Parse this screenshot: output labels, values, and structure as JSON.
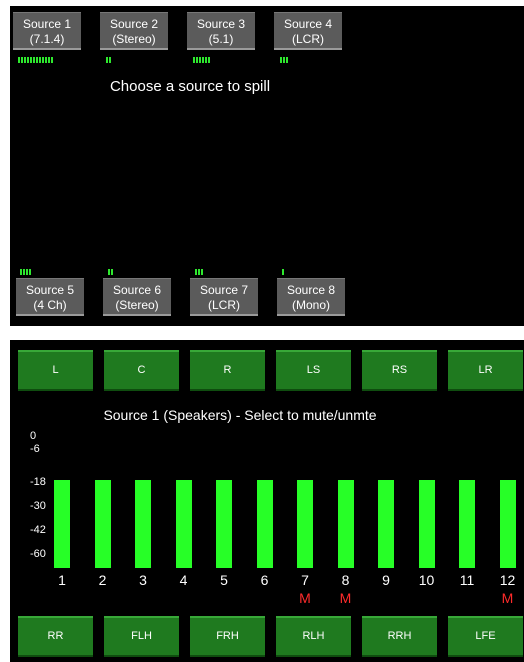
{
  "sources_top": [
    {
      "line1": "Source 1",
      "line2": "(7.1.4)",
      "meter_segments": 12
    },
    {
      "line1": "Source 2",
      "line2": "(Stereo)",
      "meter_segments": 2
    },
    {
      "line1": "Source 3",
      "line2": "(5.1)",
      "meter_segments": 6
    },
    {
      "line1": "Source 4",
      "line2": "(LCR)",
      "meter_segments": 3
    }
  ],
  "spill_prompt": "Choose a source to spill",
  "sources_bottom": [
    {
      "line1": "Source 5",
      "line2": "(4 Ch)",
      "meter_segments": 4
    },
    {
      "line1": "Source 6",
      "line2": "(Stereo)",
      "meter_segments": 2
    },
    {
      "line1": "Source 7",
      "line2": "(LCR)",
      "meter_segments": 3
    },
    {
      "line1": "Source 8",
      "line2": "(Mono)",
      "meter_segments": 1
    }
  ],
  "top_channel_buttons": [
    "L",
    "C",
    "R",
    "LS",
    "RS",
    "LR"
  ],
  "bottom_caption": "Source 1 (Speakers) - Select to mute/unmte",
  "scale_labels": [
    "0",
    "-6",
    "-18",
    "-30",
    "-42",
    "-60"
  ],
  "channels": [
    {
      "num": "1",
      "level": 1.0,
      "muted": false
    },
    {
      "num": "2",
      "level": 1.0,
      "muted": false
    },
    {
      "num": "3",
      "level": 1.0,
      "muted": false
    },
    {
      "num": "4",
      "level": 1.0,
      "muted": false
    },
    {
      "num": "5",
      "level": 1.0,
      "muted": false
    },
    {
      "num": "6",
      "level": 1.0,
      "muted": false
    },
    {
      "num": "7",
      "level": 1.0,
      "muted": true
    },
    {
      "num": "8",
      "level": 1.0,
      "muted": true
    },
    {
      "num": "9",
      "level": 1.0,
      "muted": false
    },
    {
      "num": "10",
      "level": 1.0,
      "muted": false
    },
    {
      "num": "11",
      "level": 1.0,
      "muted": false
    },
    {
      "num": "12",
      "level": 1.0,
      "muted": true
    }
  ],
  "mute_label": "M",
  "bottom_channel_buttons": [
    "RR",
    "FLH",
    "FRH",
    "RLH",
    "RRH",
    "LFE"
  ],
  "colors": {
    "meter_green": "#2ee82e",
    "bar_green": "#27ff27",
    "mute_red": "#ff2b2b",
    "button_green": "#1f7a1f"
  }
}
